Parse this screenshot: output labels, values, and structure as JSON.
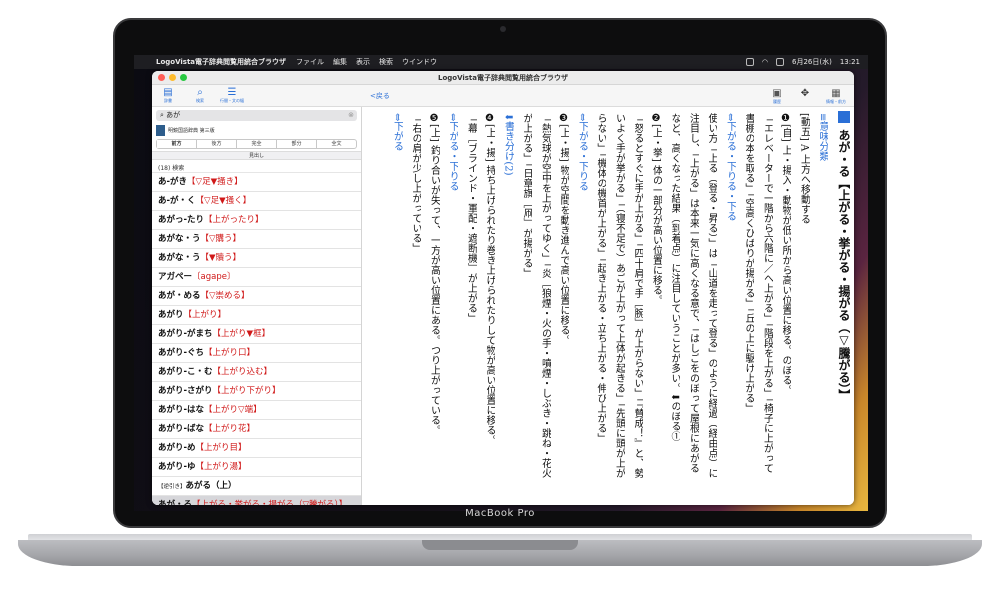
{
  "device": {
    "brand_label": "MacBook Pro"
  },
  "menubar": {
    "app_name": "LogoVista電子辞典閲覧用統合ブラウザ",
    "items": [
      "ファイル",
      "編集",
      "表示",
      "検索",
      "ウインドウ"
    ],
    "date": "6月26日(水)",
    "time": "13:21"
  },
  "window": {
    "title": "LogoVista電子辞典閲覧用統合ブラウザ",
    "toolbar": {
      "left_buttons": [
        {
          "label": "辞書",
          "icon": "book-icon"
        },
        {
          "label": "検索",
          "icon": "search-icon"
        },
        {
          "label": "行間・文の幅",
          "icon": "lines-icon"
        }
      ],
      "back_label": "<戻る",
      "right_buttons": [
        {
          "label": "履歴",
          "icon": "history-icon"
        },
        {
          "label": "",
          "icon": "settings-icon"
        },
        {
          "label": "情報・前方",
          "icon": "info-icon"
        }
      ]
    }
  },
  "sidebar": {
    "search_value": "あが",
    "dictionary_name": "明鏡国語辞典 第三版",
    "modes": [
      "前方",
      "後方",
      "完全",
      "部分",
      "全文"
    ],
    "active_mode": "前方",
    "section_label": "見出し",
    "result_count": "(18) 検索",
    "results": [
      {
        "word": "あ-がき",
        "kanji": "【▽足▼掻き】"
      },
      {
        "word": "あ-が・く",
        "kanji": "【▽足▼掻く】"
      },
      {
        "word": "あがっ-たり",
        "kanji": "【上がったり】"
      },
      {
        "word": "あがな・う",
        "kanji": "【▽購う】"
      },
      {
        "word": "あがな・う",
        "kanji": "【▼贖う】"
      },
      {
        "word": "アガペー",
        "kanji": "〔agape〕"
      },
      {
        "word": "あが・める",
        "kanji": "【▽崇める】"
      },
      {
        "word": "あがり",
        "kanji": "【上がり】"
      },
      {
        "word": "あがり-がまち",
        "kanji": "【上がり▼框】"
      },
      {
        "word": "あがり-ぐち",
        "kanji": "【上がり口】"
      },
      {
        "word": "あがり-こ・む",
        "kanji": "【上がり込む】"
      },
      {
        "word": "あがり-さがり",
        "kanji": "【上がり下がり】"
      },
      {
        "word": "あがり-はな",
        "kanji": "【上がり▽端】"
      },
      {
        "word": "あがり-ばな",
        "kanji": "【上がり花】"
      },
      {
        "word": "あがり-め",
        "kanji": "【上がり目】"
      },
      {
        "word": "あがり-ゆ",
        "kanji": "【上がり湯】"
      },
      {
        "word": "あがる（上）",
        "kanji": "",
        "prefix": "【逆引き】"
      },
      {
        "word": "あが・る",
        "kanji": "【上がる・挙がる・揚がる（▽騰がる）】"
      }
    ],
    "selected_index": 17
  },
  "entry": {
    "headword": "あが・る【上がる・挙がる・揚がる（▽騰がる）】",
    "columns": [
      {
        "text": "≡意味分類",
        "style": "blue"
      },
      {
        "text": "[動五] A 上方へ移動する",
        "style": "normal"
      },
      {
        "text": "❶[自] 上・揚入・動物が低い所から高い位置に移る。のぼる。",
        "style": "normal"
      },
      {
        "text": "「エレベーターで一階から六階に／へ上がる」「階段を上がる」「椅子に上がって",
        "style": "normal"
      },
      {
        "text": "書棚の本を取る」「空高くひばりが揚がる」「丘の上に駆け上がる」",
        "style": "normal"
      },
      {
        "text": "⇔下がる・下りる・下る",
        "style": "blue"
      },
      {
        "text": "使い方「上る（登る・昇る）」は「山道を走って登る」のように経過（経由点）に",
        "style": "normal"
      },
      {
        "text": "注目し、「上がる」は本来一気に高くなる意で、「はしごをのぼって屋根にあがる",
        "style": "normal"
      },
      {
        "text": "など、高くなった結果（到着点）に注目していうことが多い。⬇のぼる①",
        "style": "normal"
      },
      {
        "text": "❷[上・挙] 体の一部分が高い位置に移る。",
        "style": "normal"
      },
      {
        "text": "「怒るとすぐに手が上がる」「四十肩で手［腕］が上がらない」「『賛成！』と、勢",
        "style": "normal"
      },
      {
        "text": "いよく手が挙がる」「（寝不足で）あごが上がって上体が起きる」「先頭に頭が上が",
        "style": "normal"
      },
      {
        "text": "らない」「機体の機首が上がる」「起き上がる・立ち上がる・伸び上がる」",
        "style": "normal"
      },
      {
        "text": "⇔下がる・下りる",
        "style": "blue"
      },
      {
        "text": "❸[上・揚] 物が空間を動き進んで高い位置に移る。",
        "style": "normal"
      },
      {
        "text": "「熱気球が空中を上がってゆく」「炎［狼煙・火の手・噴煙・しぶき・跳ね・花火",
        "style": "normal"
      },
      {
        "text": "が上がる」「日章旗［凧］が揚がる」",
        "style": "normal"
      },
      {
        "text": "⬇書き分け(2)",
        "style": "blue"
      },
      {
        "text": "❹[上・揚] 持ち上げられたり巻き上げられたりして物が高い位置に移る。",
        "style": "normal"
      },
      {
        "text": "「幕［ブラインド・軍配・遮断機］が上がる」",
        "style": "normal"
      },
      {
        "text": "⇔下がる・下りる",
        "style": "blue"
      },
      {
        "text": "❺[上] 釣り合いが失って、一方が高い位置にある。つり上がっている。",
        "style": "normal"
      },
      {
        "text": "「右の肩が少し上がっている」",
        "style": "normal"
      },
      {
        "text": "⇔下がる",
        "style": "blue"
      }
    ]
  },
  "colors": {
    "accent": "#2a6fd6",
    "headword_red": "#d01818",
    "selected_row": "#d6d6da"
  }
}
